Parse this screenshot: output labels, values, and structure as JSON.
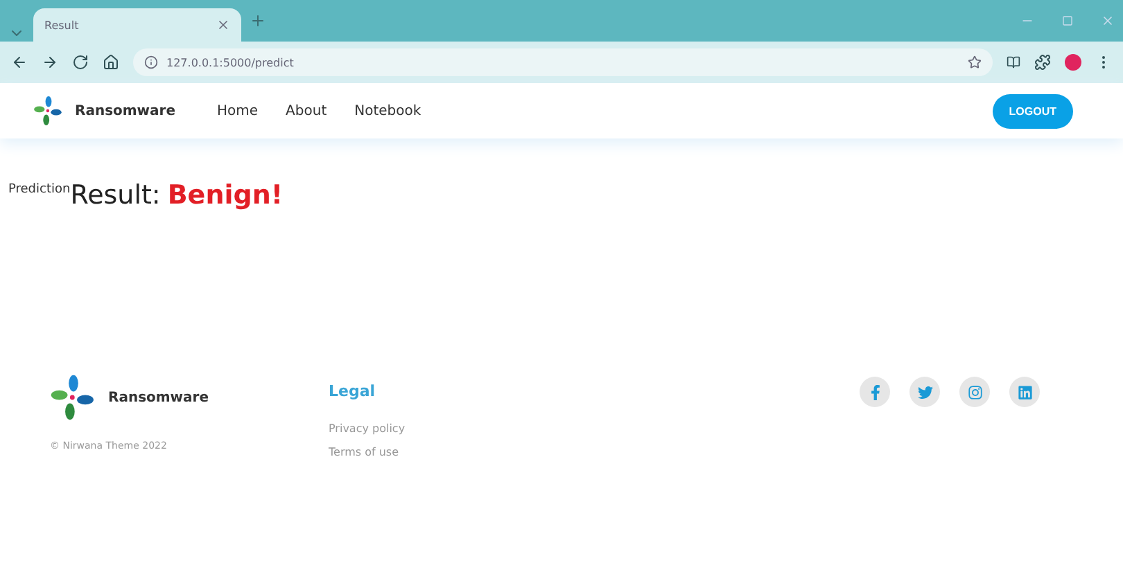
{
  "browser": {
    "tab_title": "Result",
    "url": "127.0.0.1:5000/predict"
  },
  "navbar": {
    "brand": "Ransomware",
    "links": [
      "Home",
      "About",
      "Notebook"
    ],
    "button": "LOGOUT"
  },
  "result": {
    "label": "Prediction",
    "prefix": "Result:",
    "value": "Benign!"
  },
  "footer": {
    "brand": "Ransomware",
    "copyright": "© Nirwana Theme 2022",
    "legal_title": "Legal",
    "legal_links": [
      "Privacy policy",
      "Terms of use"
    ],
    "social": [
      {
        "kind": "facebook"
      },
      {
        "kind": "twitter"
      },
      {
        "kind": "instagram"
      },
      {
        "kind": "linkedin"
      }
    ]
  }
}
